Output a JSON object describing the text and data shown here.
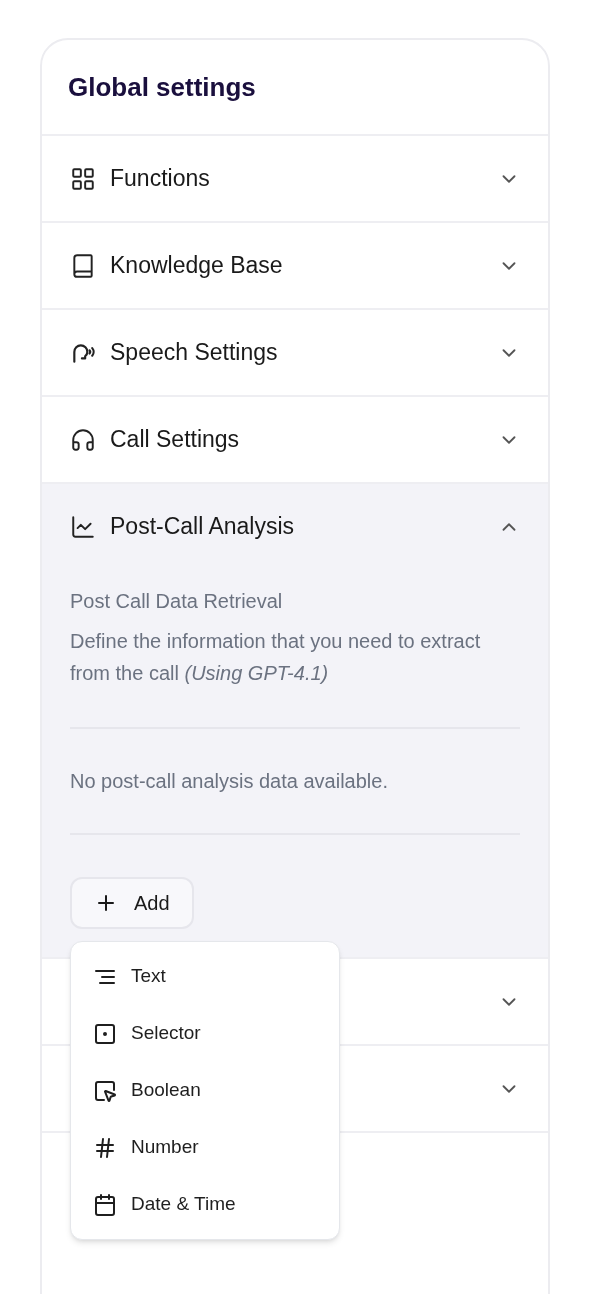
{
  "panel": {
    "title": "Global settings"
  },
  "sections": [
    {
      "label": "Functions",
      "expanded": false
    },
    {
      "label": "Knowledge Base",
      "expanded": false
    },
    {
      "label": "Speech Settings",
      "expanded": false
    },
    {
      "label": "Call Settings",
      "expanded": false
    },
    {
      "label": "Post-Call Analysis",
      "expanded": true,
      "content": {
        "heading": "Post Call Data Retrieval",
        "description": "Define the information that you need to extract from the call  *(Using GPT-4.1)*",
        "empty_message": "No post-call analysis data available.",
        "add_button": "Add"
      }
    },
    {
      "expanded": false
    },
    {
      "expanded": false
    }
  ],
  "add_menu": {
    "open": true,
    "items": [
      {
        "label": "Text"
      },
      {
        "label": "Selector"
      },
      {
        "label": "Boolean"
      },
      {
        "label": "Number"
      },
      {
        "label": "Date & Time"
      }
    ]
  }
}
